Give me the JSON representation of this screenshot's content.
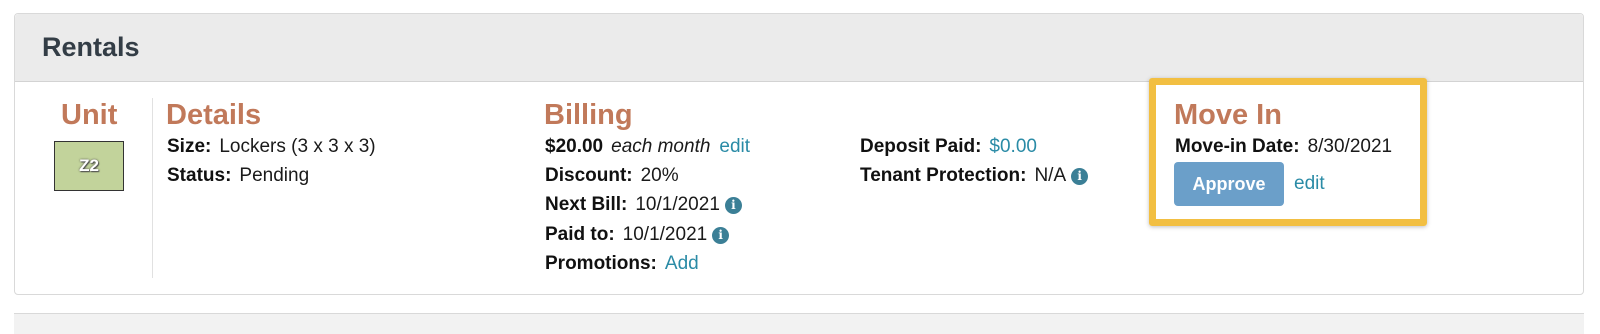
{
  "panel": {
    "title": "Rentals"
  },
  "unit": {
    "heading": "Unit",
    "code": "Z2",
    "color": "#c2d39b"
  },
  "details": {
    "heading": "Details",
    "size_label": "Size:",
    "size_value": "Lockers (3 x 3 x 3)",
    "status_label": "Status:",
    "status_value": "Pending"
  },
  "billing": {
    "heading": "Billing",
    "amount": "$20.00",
    "frequency": "each month",
    "edit_link": "edit",
    "discount_label": "Discount:",
    "discount_value": "20%",
    "next_bill_label": "Next Bill:",
    "next_bill_value": "10/1/2021",
    "paid_to_label": "Paid to:",
    "paid_to_value": "10/1/2021",
    "promotions_label": "Promotions:",
    "promotions_link": "Add",
    "deposit_label": "Deposit Paid:",
    "deposit_value": "$0.00",
    "tenant_label": "Tenant Protection:",
    "tenant_value": "N/A"
  },
  "move_in": {
    "heading": "Move In",
    "date_label": "Move-in Date:",
    "date_value": "8/30/2021",
    "approve_label": "Approve",
    "edit_link": "edit",
    "highlight_color": "#f2bf42"
  },
  "icons": {
    "info": "info-icon"
  },
  "colors": {
    "heading": "#c1795a",
    "link": "#2a8ba6",
    "button": "#6b9fc9"
  }
}
